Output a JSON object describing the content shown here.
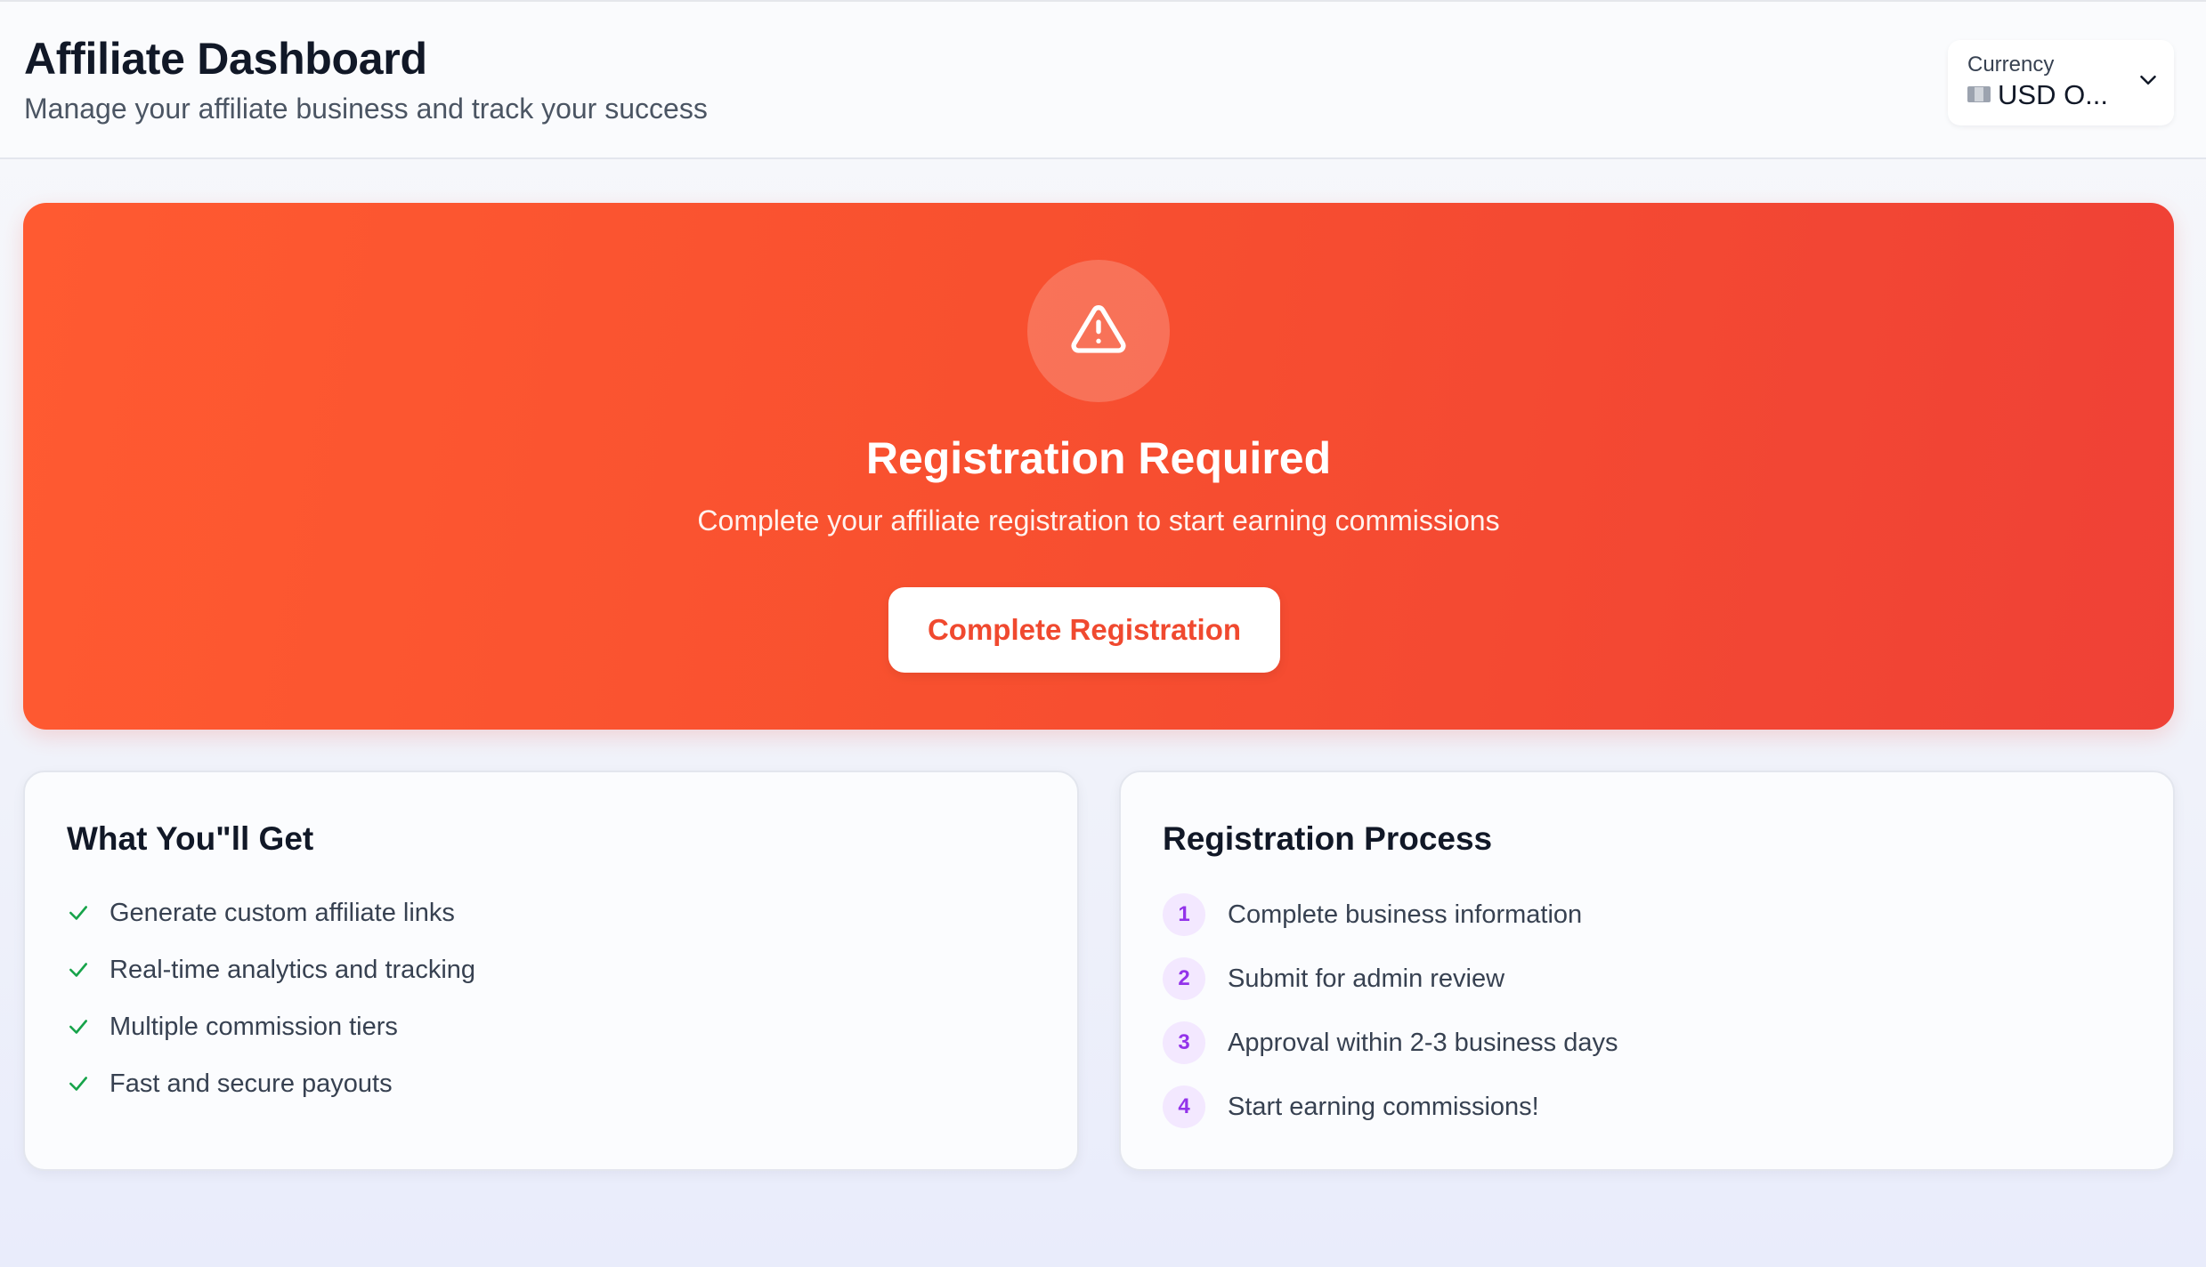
{
  "header": {
    "title": "Affiliate Dashboard",
    "subtitle": "Manage your affiliate business and track your success",
    "currency": {
      "label": "Currency",
      "value": "USD O...",
      "flag_icon": "flag-icon",
      "chevron_icon": "chevron-down-icon"
    }
  },
  "banner": {
    "icon": "warning-triangle-icon",
    "title": "Registration Required",
    "text": "Complete your affiliate registration to start earning commissions",
    "button_label": "Complete Registration",
    "colors": {
      "gradient_start": "#ff5a31",
      "gradient_end": "#ef4136"
    }
  },
  "benefits": {
    "title": "What You\"ll Get",
    "icon": "check-icon",
    "items": [
      "Generate custom affiliate links",
      "Real-time analytics and tracking",
      "Multiple commission tiers",
      "Fast and secure payouts"
    ]
  },
  "process": {
    "title": "Registration Process",
    "steps": [
      {
        "number": "1",
        "text": "Complete business information"
      },
      {
        "number": "2",
        "text": "Submit for admin review"
      },
      {
        "number": "3",
        "text": "Approval within 2-3 business days"
      },
      {
        "number": "4",
        "text": "Start earning commissions!"
      }
    ]
  },
  "colors": {
    "check": "#16a34a",
    "step_badge_bg": "#f3e8ff",
    "step_badge_text": "#9333ea",
    "button_text": "#f0492f"
  }
}
